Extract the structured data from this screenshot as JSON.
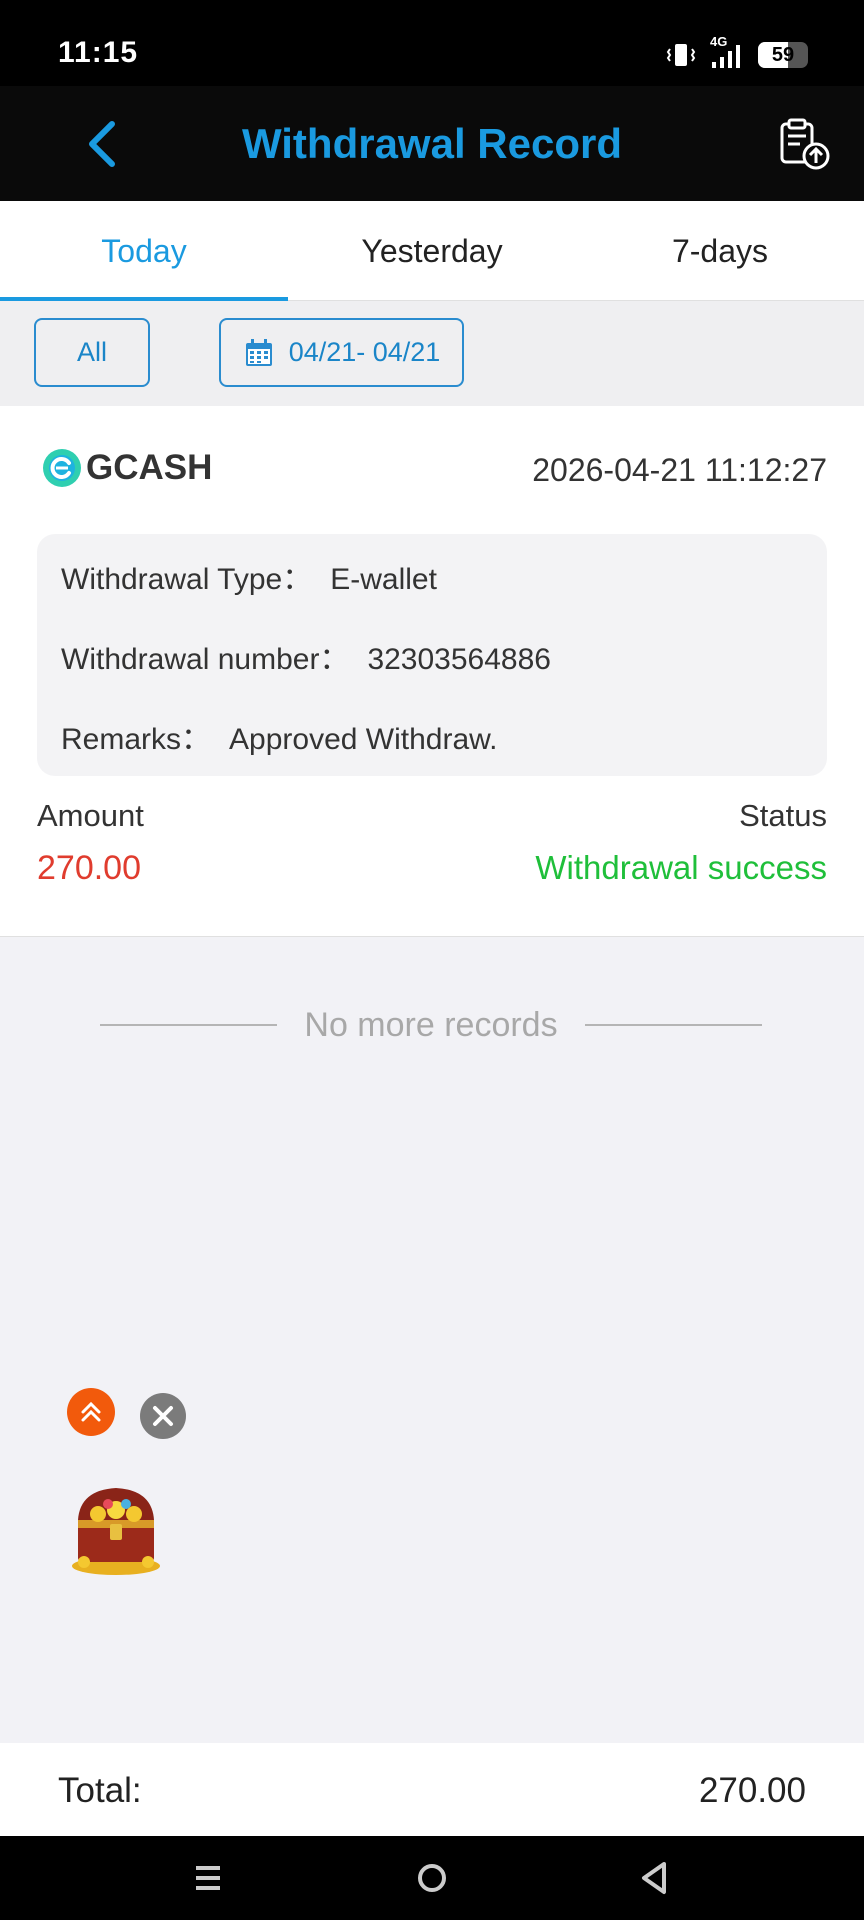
{
  "status_bar": {
    "time": "11:15",
    "network": "4G",
    "battery_text": "59",
    "battery_level": 0.59
  },
  "header": {
    "title": "Withdrawal Record"
  },
  "tabs": [
    {
      "label": "Today",
      "active": true
    },
    {
      "label": "Yesterday",
      "active": false
    },
    {
      "label": "7-days",
      "active": false
    }
  ],
  "filters": {
    "all_label": "All",
    "date_range": "04/21- 04/21"
  },
  "record": {
    "method": "GCASH",
    "datetime": "2026-04-21 11:12:27",
    "withdrawal_type_label": "Withdrawal Type：",
    "withdrawal_type_value": "E-wallet",
    "withdrawal_number_label": "Withdrawal number：",
    "withdrawal_number_value": "32303564886",
    "remarks_label": "Remarks：",
    "remarks_value": "Approved Withdraw.",
    "amount_label": "Amount",
    "amount_value": "270.00",
    "status_label": "Status",
    "status_value": "Withdrawal success"
  },
  "list_end_text": "No more records",
  "footer": {
    "total_label": "Total:",
    "total_value": "270.00"
  },
  "colors": {
    "accent": "#1a9ae0",
    "amount": "#e03c2e",
    "success": "#1fbf3a",
    "gcash": "#2fcfb0"
  },
  "icons": [
    "back-arrow-icon",
    "export-record-icon",
    "calendar-icon",
    "gcash-logo-icon",
    "scroll-top-icon",
    "close-icon",
    "treasure-chest-icon",
    "menu-icon",
    "home-icon",
    "back-icon"
  ]
}
